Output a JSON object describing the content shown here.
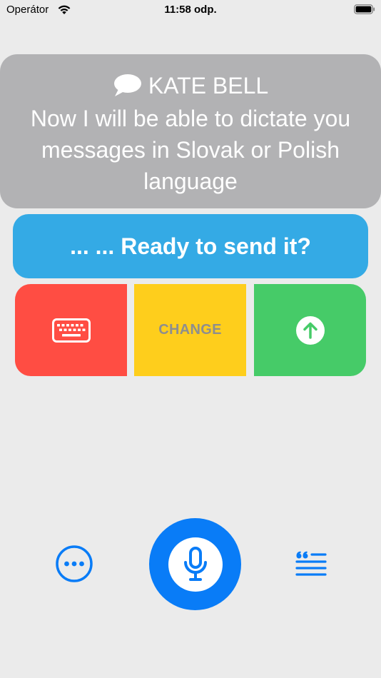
{
  "status_bar": {
    "carrier": "Operátor",
    "time": "11:58 odp."
  },
  "message": {
    "sender": "KATE BELL",
    "text": "Now I will be able to dictate you messages in Slovak or Polish language"
  },
  "banner": {
    "text": "...  ...  Ready to send it?"
  },
  "actions": {
    "keyboard_icon": "keyboard-icon",
    "change_label": "CHANGE",
    "send_icon": "arrow-up-circle-icon"
  },
  "bottom": {
    "more_icon": "ellipsis-circle-icon",
    "mic_icon": "microphone-icon",
    "quote_icon": "quote-list-icon"
  },
  "colors": {
    "background": "#ebebeb",
    "message_card": "#b2b2b4",
    "banner": "#34aae5",
    "keyboard_tile": "#ff4d43",
    "change_tile": "#fece1c",
    "send_tile": "#46cb68",
    "accent": "#097cf7"
  }
}
